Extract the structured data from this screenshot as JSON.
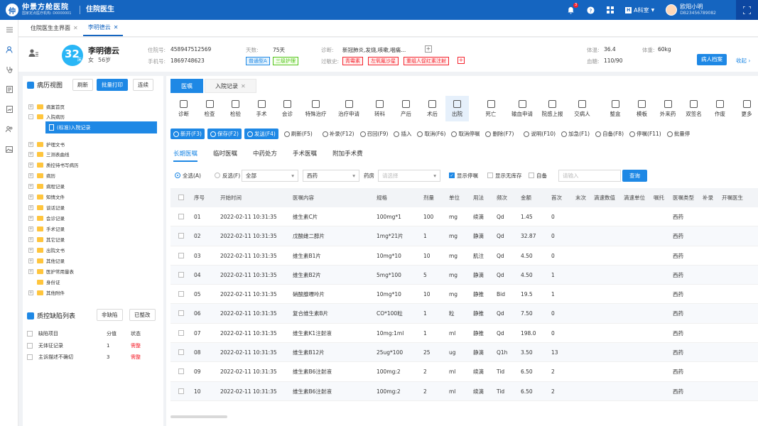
{
  "app": {
    "name": "仲景方舱医院",
    "sub": "国家定点医疗机构: D0000001",
    "system": "住院医生"
  },
  "topbar": {
    "notif_count": "3",
    "dept": "A科室",
    "user_name": "欧阳小明",
    "user_id": "DB23456789082"
  },
  "page_tabs": [
    {
      "label": "住院医生主界面"
    },
    {
      "label": "李明德云"
    }
  ],
  "patient": {
    "bed": "32",
    "bed_unit": "床",
    "name": "李明德云",
    "gender": "女",
    "age": "56岁",
    "admission_label": "住院号:",
    "admission_no": "458947512569",
    "phone_label": "手机号:",
    "phone": "1869748623",
    "days_label": "天数:",
    "days": "75天",
    "tags": [
      "普通型A",
      "三级护理"
    ],
    "diagnosis_label": "诊断:",
    "diagnosis": "新冠肺炎,发烧,咳嗽,咽痛...",
    "allergy_label": "过敏史:",
    "allergies": [
      "青霉素",
      "左氧氟沙星",
      "重组人促红素注射"
    ],
    "temp_label": "体温:",
    "temp": "36.4",
    "weight_label": "体重:",
    "weight": "60kg",
    "bp_label": "血糖:",
    "bp": "110/90",
    "archive_btn": "病人档案",
    "collapse": "收起"
  },
  "left": {
    "title": "病历视图",
    "buttons": [
      "刷新",
      "批量打印",
      "连续"
    ],
    "tree": [
      {
        "label": "病案首页",
        "pm": "+"
      },
      {
        "label": "入院病历",
        "pm": "-"
      },
      {
        "label": "护理文书",
        "pm": "+"
      },
      {
        "label": "三测表曲线",
        "pm": "+"
      },
      {
        "label": "质控待书写病历",
        "pm": "+"
      },
      {
        "label": "病历",
        "pm": "+"
      },
      {
        "label": "病程记录",
        "pm": "+"
      },
      {
        "label": "知情文件",
        "pm": "+"
      },
      {
        "label": "谈话记录",
        "pm": "+"
      },
      {
        "label": "会诊记录",
        "pm": "+"
      },
      {
        "label": "手术记录",
        "pm": "+"
      },
      {
        "label": "其它记录",
        "pm": "+"
      },
      {
        "label": "出院文书",
        "pm": "+"
      },
      {
        "label": "其他记录",
        "pm": "+"
      },
      {
        "label": "医护常用量表",
        "pm": "+"
      },
      {
        "label": "身份证",
        "pm": ""
      },
      {
        "label": "其他附件",
        "pm": "+"
      }
    ],
    "selected_doc": "(标准)入院记录",
    "defect_title": "质控缺陷列表",
    "defect_buttons": [
      "非缺陷",
      "已整改"
    ],
    "defect_headers": [
      "缺陷项目",
      "分值",
      "状态"
    ],
    "defects": [
      {
        "item": "无体征记录",
        "score": "1",
        "status": "需整"
      },
      {
        "item": "主诉描述不确切",
        "score": "3",
        "status": "需整"
      }
    ]
  },
  "main": {
    "tabs": [
      "医嘱",
      "入院记录"
    ],
    "tools": [
      "诊断",
      "检查",
      "检验",
      "手术",
      "会诊",
      "特殊治疗",
      "治疗申请",
      "转科",
      "产后",
      "术后",
      "出院",
      "死亡",
      "输血申请",
      "院感上报",
      "交病人",
      "整盒",
      "模板",
      "外来药",
      "双签名",
      "作废",
      "更多"
    ],
    "actions": [
      "新开(F3)",
      "保存(F2)",
      "发送(F4)",
      "刷新(F5)",
      "补录(F12)",
      "召回(F9)",
      "插入",
      "取消(F6)",
      "取消停嘱",
      "删除(F7)",
      "说明(F10)",
      "加急(F1)",
      "自备(F8)",
      "停嘱(F11)",
      "批量停"
    ],
    "subtabs": [
      "长期医嘱",
      "临时医嘱",
      "中药处方",
      "手术医嘱",
      "附加手术费"
    ],
    "filter": {
      "all": "全选(A)",
      "invert": "反选(F)",
      "sel1": "全部",
      "sel2": "西药",
      "pharmacy_label": "药房",
      "pharmacy_ph": "请选择",
      "show_stop": "显示停嘱",
      "show_nostock": "显示无库存",
      "self": "自备",
      "input_ph": "请输入",
      "query": "查询"
    },
    "table": {
      "headers": [
        "序号",
        "开始时间",
        "医嘱内容",
        "规格",
        "剂量",
        "单位",
        "用法",
        "频次",
        "金额",
        "首次",
        "末次",
        "滴速数值",
        "滴速单位",
        "嘱托",
        "医嘱类型",
        "补录",
        "开嘱医生"
      ],
      "rows": [
        [
          "01",
          "2022-02-11 10:31:35",
          "维生素C片",
          "100mg*1",
          "100",
          "mg",
          "续滴",
          "Qd",
          "1.45",
          "0",
          "西药"
        ],
        [
          "02",
          "2022-02-11 10:31:35",
          "戊酸雌二醇片",
          "1mg*21片",
          "1",
          "mg",
          "静滴",
          "Qd",
          "32.87",
          "0",
          "西药"
        ],
        [
          "03",
          "2022-02-11 10:31:35",
          "维生素B1片",
          "10mg*10",
          "10",
          "mg",
          "肌注",
          "Qd",
          "4.50",
          "0",
          "西药"
        ],
        [
          "04",
          "2022-02-11 10:31:35",
          "维生素B2片",
          "5mg*100",
          "5",
          "mg",
          "静滴",
          "Qd",
          "4.50",
          "1",
          "西药"
        ],
        [
          "05",
          "2022-02-11 10:31:35",
          "硝酸腺嘌呤片",
          "10mg*10",
          "10",
          "mg",
          "静推",
          "Bid",
          "19.5",
          "1",
          "西药"
        ],
        [
          "06",
          "2022-02-11 10:31:35",
          "复合维生素B片",
          "CO*100粒",
          "1",
          "粒",
          "静推",
          "Qd",
          "7.50",
          "0",
          "西药"
        ],
        [
          "07",
          "2022-02-11 10:31:35",
          "维生素K1注射液",
          "10mg:1ml",
          "1",
          "ml",
          "静推",
          "Qd",
          "198.0",
          "0",
          "西药"
        ],
        [
          "08",
          "2022-02-11 10:31:35",
          "维生素B12片",
          "25ug*100",
          "25",
          "ug",
          "静滴",
          "Q1h",
          "3.50",
          "13",
          "西药"
        ],
        [
          "09",
          "2022-02-11 10:31:35",
          "维生素B6注射液",
          "100mg:2",
          "2",
          "ml",
          "续滴",
          "Tid",
          "6.50",
          "2",
          "西药"
        ],
        [
          "10",
          "2022-02-11 10:31:35",
          "维生素B6注射液",
          "100mg:2",
          "2",
          "ml",
          "续滴",
          "Tid",
          "6.50",
          "2",
          "西药"
        ]
      ]
    }
  }
}
